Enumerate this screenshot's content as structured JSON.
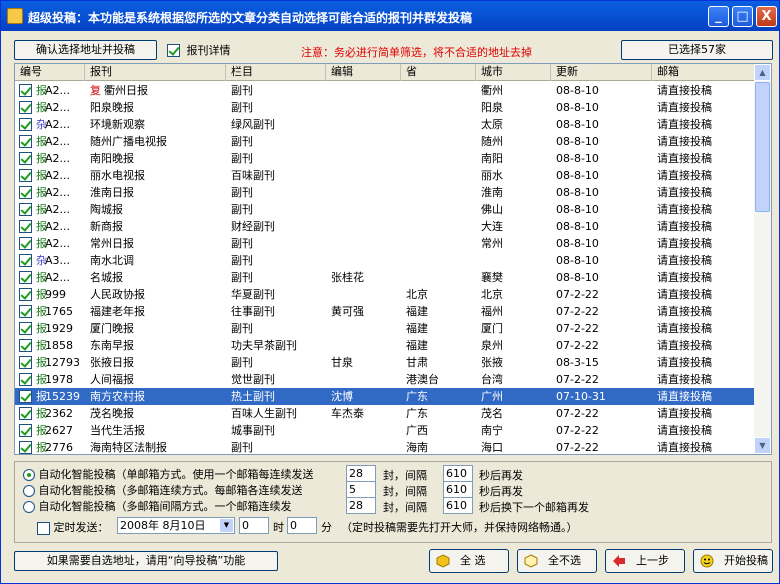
{
  "window": {
    "title": "超级投稿：本功能是系统根据您所选的文章分类自动选择可能合适的报刊并群发投稿",
    "minimize": "_",
    "maximize": "□",
    "close": "X"
  },
  "toolbar": {
    "confirm_label": "确认选择地址并投稿",
    "detail_label": "报刊详情",
    "notice": "注意：务必进行简单筛选，将不合适的地址去掉",
    "selected_count": "已选择57家"
  },
  "columns": [
    "编号",
    "报刊",
    "栏目",
    "编辑",
    "省",
    "城市",
    "更新",
    "邮箱"
  ],
  "rows": [
    {
      "type": "报",
      "no": "A2...",
      "pre": "复",
      "name": "衢州日报",
      "col": "副刊",
      "editor": "",
      "prov": "",
      "city": "衢州",
      "date": "08-8-10",
      "mail": "请直接投稿"
    },
    {
      "type": "报",
      "no": "A2...",
      "name": "阳泉晚报",
      "col": "副刊",
      "editor": "",
      "prov": "",
      "city": "阳泉",
      "date": "08-8-10",
      "mail": "请直接投稿"
    },
    {
      "type": "杂",
      "no": "A2...",
      "name": "环境新观察",
      "col": "绿风副刊",
      "editor": "",
      "prov": "",
      "city": "太原",
      "date": "08-8-10",
      "mail": "请直接投稿"
    },
    {
      "type": "报",
      "no": "A2...",
      "name": "随州广播电视报",
      "col": "副刊",
      "editor": "",
      "prov": "",
      "city": "随州",
      "date": "08-8-10",
      "mail": "请直接投稿"
    },
    {
      "type": "报",
      "no": "A2...",
      "name": "南阳晚报",
      "col": "副刊",
      "editor": "",
      "prov": "",
      "city": "南阳",
      "date": "08-8-10",
      "mail": "请直接投稿"
    },
    {
      "type": "报",
      "no": "A2...",
      "name": "丽水电视报",
      "col": "百味副刊",
      "editor": "",
      "prov": "",
      "city": "丽水",
      "date": "08-8-10",
      "mail": "请直接投稿"
    },
    {
      "type": "报",
      "no": "A2...",
      "name": "淮南日报",
      "col": "副刊",
      "editor": "",
      "prov": "",
      "city": "淮南",
      "date": "08-8-10",
      "mail": "请直接投稿"
    },
    {
      "type": "报",
      "no": "A2...",
      "name": "陶城报",
      "col": "副刊",
      "editor": "",
      "prov": "",
      "city": "佛山",
      "date": "08-8-10",
      "mail": "请直接投稿"
    },
    {
      "type": "报",
      "no": "A2...",
      "name": "新商报",
      "col": "财经副刊",
      "editor": "",
      "prov": "",
      "city": "大连",
      "date": "08-8-10",
      "mail": "请直接投稿"
    },
    {
      "type": "报",
      "no": "A2...",
      "name": "常州日报",
      "col": "副刊",
      "editor": "",
      "prov": "",
      "city": "常州",
      "date": "08-8-10",
      "mail": "请直接投稿"
    },
    {
      "type": "杂",
      "no": "A3...",
      "name": "南水北调",
      "col": "副刊",
      "editor": "",
      "prov": "",
      "city": "",
      "date": "08-8-10",
      "mail": "请直接投稿"
    },
    {
      "type": "报",
      "no": "A2...",
      "name": "名城报",
      "col": "副刊",
      "editor": "张桂花",
      "prov": "",
      "city": "襄樊",
      "date": "08-8-10",
      "mail": "请直接投稿"
    },
    {
      "type": "报",
      "no": "999",
      "name": "人民政协报",
      "col": "华夏副刊",
      "editor": "",
      "prov": "北京",
      "city": "北京",
      "date": "07-2-22",
      "mail": "请直接投稿"
    },
    {
      "type": "报",
      "no": "1765",
      "name": "福建老年报",
      "col": "往事副刊",
      "editor": "黄可强",
      "prov": "福建",
      "city": "福州",
      "date": "07-2-22",
      "mail": "请直接投稿"
    },
    {
      "type": "报",
      "no": "1929",
      "name": "厦门晚报",
      "col": "副刊",
      "editor": "",
      "prov": "福建",
      "city": "厦门",
      "date": "07-2-22",
      "mail": "请直接投稿"
    },
    {
      "type": "报",
      "no": "1858",
      "name": "东南早报",
      "col": "功夫早茶副刊",
      "editor": "",
      "prov": "福建",
      "city": "泉州",
      "date": "07-2-22",
      "mail": "请直接投稿"
    },
    {
      "type": "报",
      "no": "12793",
      "name": "张掖日报",
      "col": "副刊",
      "editor": "甘泉",
      "prov": "甘肃",
      "city": "张掖",
      "date": "08-3-15",
      "mail": "请直接投稿"
    },
    {
      "type": "报",
      "no": "1978",
      "name": "人间福报",
      "col": "觉世副刊",
      "editor": "",
      "prov": "港澳台",
      "city": "台湾",
      "date": "07-2-22",
      "mail": "请直接投稿"
    },
    {
      "type": "报",
      "no": "15239",
      "name": "南方农村报",
      "col": "热土副刊",
      "editor": "沈博",
      "prov": "广东",
      "city": "广州",
      "date": "07-10-31",
      "mail": "请直接投稿",
      "selected": true
    },
    {
      "type": "报",
      "no": "2362",
      "name": "茂名晚报",
      "col": "百味人生副刊",
      "editor": "车杰泰",
      "prov": "广东",
      "city": "茂名",
      "date": "07-2-22",
      "mail": "请直接投稿"
    },
    {
      "type": "报",
      "no": "2627",
      "name": "当代生活报",
      "col": "城事副刊",
      "editor": "",
      "prov": "广西",
      "city": "南宁",
      "date": "07-2-22",
      "mail": "请直接投稿"
    },
    {
      "type": "报",
      "no": "2776",
      "name": "海南特区法制报",
      "col": "副刊",
      "editor": "",
      "prov": "海南",
      "city": "海口",
      "date": "07-2-22",
      "mail": "请直接投稿"
    }
  ],
  "options": {
    "r1": {
      "label": "自动化智能投稿（单邮箱方式。使用一个邮箱每连续发送",
      "count": "28",
      "unit": "封，间隔",
      "interval": "610",
      "tail": "秒后再发"
    },
    "r2": {
      "label": "自动化智能投稿（多邮箱连续方式。每邮箱各连续发送",
      "count": "5",
      "unit": "封，间隔",
      "interval": "610",
      "tail": "秒后再发"
    },
    "r3": {
      "label": "自动化智能投稿（多邮箱间隔方式。一个邮箱连续发",
      "count": "28",
      "unit": "封，间隔",
      "interval": "610",
      "tail": "秒后换下一个邮箱再发"
    },
    "timer": {
      "label": "定时发送：",
      "date": "2008年 8月10日",
      "hour": "0",
      "hour_unit": "时",
      "minute": "0",
      "minute_unit": "分",
      "note": "（定时投稿需要先打开大师，并保持网络畅通。）"
    }
  },
  "bottom": {
    "guide": "如果需要自选地址，请用“向导投稿”功能",
    "select_all": "全 选",
    "select_none": "全不选",
    "prev": "上一步",
    "start": "开始投稿"
  }
}
